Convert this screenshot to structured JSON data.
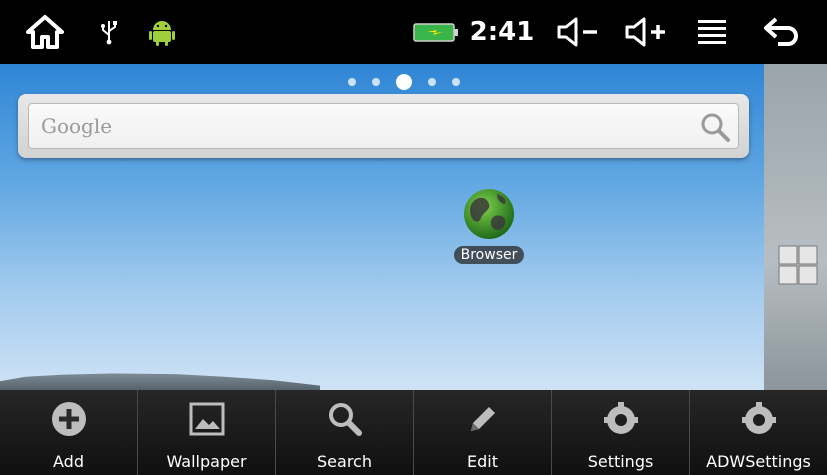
{
  "status_bar": {
    "time": "2:41",
    "icons": [
      "home-icon",
      "usb-icon",
      "android-icon",
      "battery-charging-icon",
      "volume-down-icon",
      "volume-up-icon",
      "menu-icon",
      "back-icon"
    ]
  },
  "home": {
    "page_indicator": {
      "count": 5,
      "active": 3
    },
    "search": {
      "placeholder": "Google"
    },
    "apps": [
      {
        "label": "Browser",
        "icon": "globe-icon"
      }
    ]
  },
  "menu": {
    "items": [
      {
        "label": "Add",
        "icon": "add-icon"
      },
      {
        "label": "Wallpaper",
        "icon": "wallpaper-icon"
      },
      {
        "label": "Search",
        "icon": "search-icon"
      },
      {
        "label": "Edit",
        "icon": "edit-icon"
      },
      {
        "label": "Settings",
        "icon": "settings-icon"
      },
      {
        "label": "ADWSettings",
        "icon": "adw-settings-icon"
      }
    ]
  },
  "colors": {
    "sky_top": "#2f86d6",
    "sky_bottom": "#cfe3f5",
    "menu_bg": "#1e1e1e",
    "battery": "#39b54a"
  }
}
